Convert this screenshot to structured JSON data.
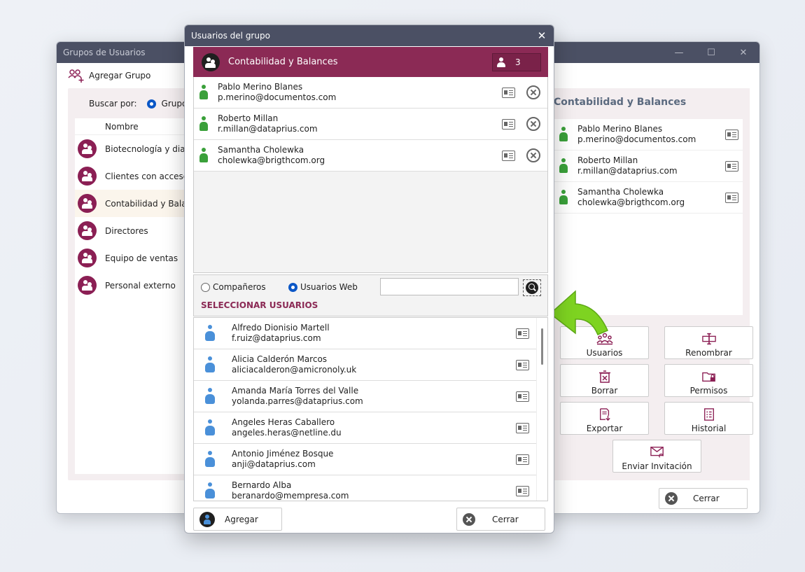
{
  "bg_window": {
    "title": "Grupos de Usuarios",
    "controls": [
      "—",
      "☐",
      "✕"
    ],
    "add_group_label": "Agregar Grupo",
    "search_by_label": "Buscar por:",
    "search_option": "Grupos",
    "list_header": "Nombre",
    "groups": [
      "Biotecnología y diagn",
      "Clientes con acceso a",
      "Contabilidad y Balanc",
      "Directores",
      "Equipo de ventas",
      "Personal externo"
    ],
    "right_title": "Contabilidad y Balances",
    "members": [
      {
        "name": "Pablo Merino Blanes",
        "email": "p.merino@documentos.com"
      },
      {
        "name": "Roberto Millan",
        "email": "r.millan@dataprius.com"
      },
      {
        "name": "Samantha Cholewka",
        "email": "cholewka@brigthcom.org"
      }
    ],
    "buttons": {
      "usuarios": "Usuarios",
      "renombrar": "Renombrar",
      "borrar": "Borrar",
      "permisos": "Permisos",
      "exportar": "Exportar",
      "historial": "Historial",
      "enviar": "Enviar Invitación",
      "cerrar": "Cerrar"
    }
  },
  "modal": {
    "title": "Usuarios del grupo",
    "close_glyph": "✕",
    "group_name": "Contabilidad y Balances",
    "member_count": "3",
    "members": [
      {
        "name": "Pablo Merino Blanes",
        "email": "p.merino@documentos.com"
      },
      {
        "name": "Roberto Millan",
        "email": "r.millan@dataprius.com"
      },
      {
        "name": "Samantha Cholewka",
        "email": "cholewka@brigthcom.org"
      }
    ],
    "filter": {
      "option_companeros": "Compañeros",
      "option_web": "Usuarios Web",
      "selected": "Usuarios Web",
      "search_value": ""
    },
    "select_title": "SELECCIONAR USUARIOS",
    "users": [
      {
        "name": "Alfredo Dionisio Martell",
        "email": "f.ruiz@dataprius.com"
      },
      {
        "name": "Alicia Calderón Marcos",
        "email": "aliciacalderon@amicronoly.uk"
      },
      {
        "name": "Amanda María Torres del Valle",
        "email": "yolanda.parres@dataprius.com"
      },
      {
        "name": "Angeles Heras Caballero",
        "email": "angeles.heras@netline.du"
      },
      {
        "name": "Antonio Jiménez Bosque",
        "email": "anji@dataprius.com"
      },
      {
        "name": "Bernardo Alba",
        "email": "beranardo@mempresa.com"
      }
    ],
    "add_label": "Agregar",
    "close_label": "Cerrar"
  },
  "colors": {
    "accent": "#8b2a55",
    "titlebar": "#4b5064",
    "arrow": "#7ed321"
  }
}
